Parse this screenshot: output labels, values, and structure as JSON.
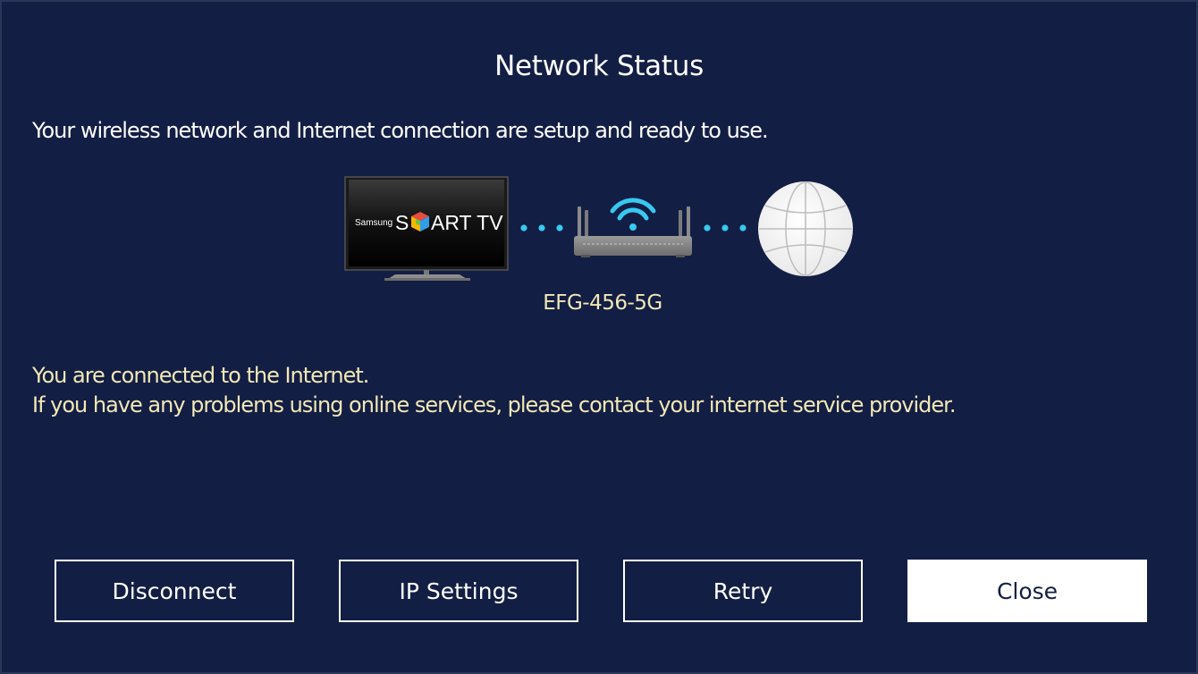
{
  "dialog": {
    "title": "Network Status",
    "intro": "Your wireless network and Internet connection are setup and ready to use."
  },
  "diagram": {
    "tv_brand": "Samsung",
    "tv_logo_prefix": "S",
    "tv_logo_suffix": "ART TV",
    "network_name": "EFG-456-5G",
    "link_color": "#39c8f0",
    "wifi_color": "#39c8f0"
  },
  "status": {
    "line1": "You are connected to the Internet.",
    "line2": "If you have any problems using online services, please contact your internet service provider."
  },
  "buttons": {
    "disconnect": "Disconnect",
    "ip_settings": "IP Settings",
    "retry": "Retry",
    "close": "Close",
    "focused": "close"
  },
  "colors": {
    "background": "#131e44",
    "highlight_text": "#f1e8b6",
    "text": "#ffffff"
  }
}
